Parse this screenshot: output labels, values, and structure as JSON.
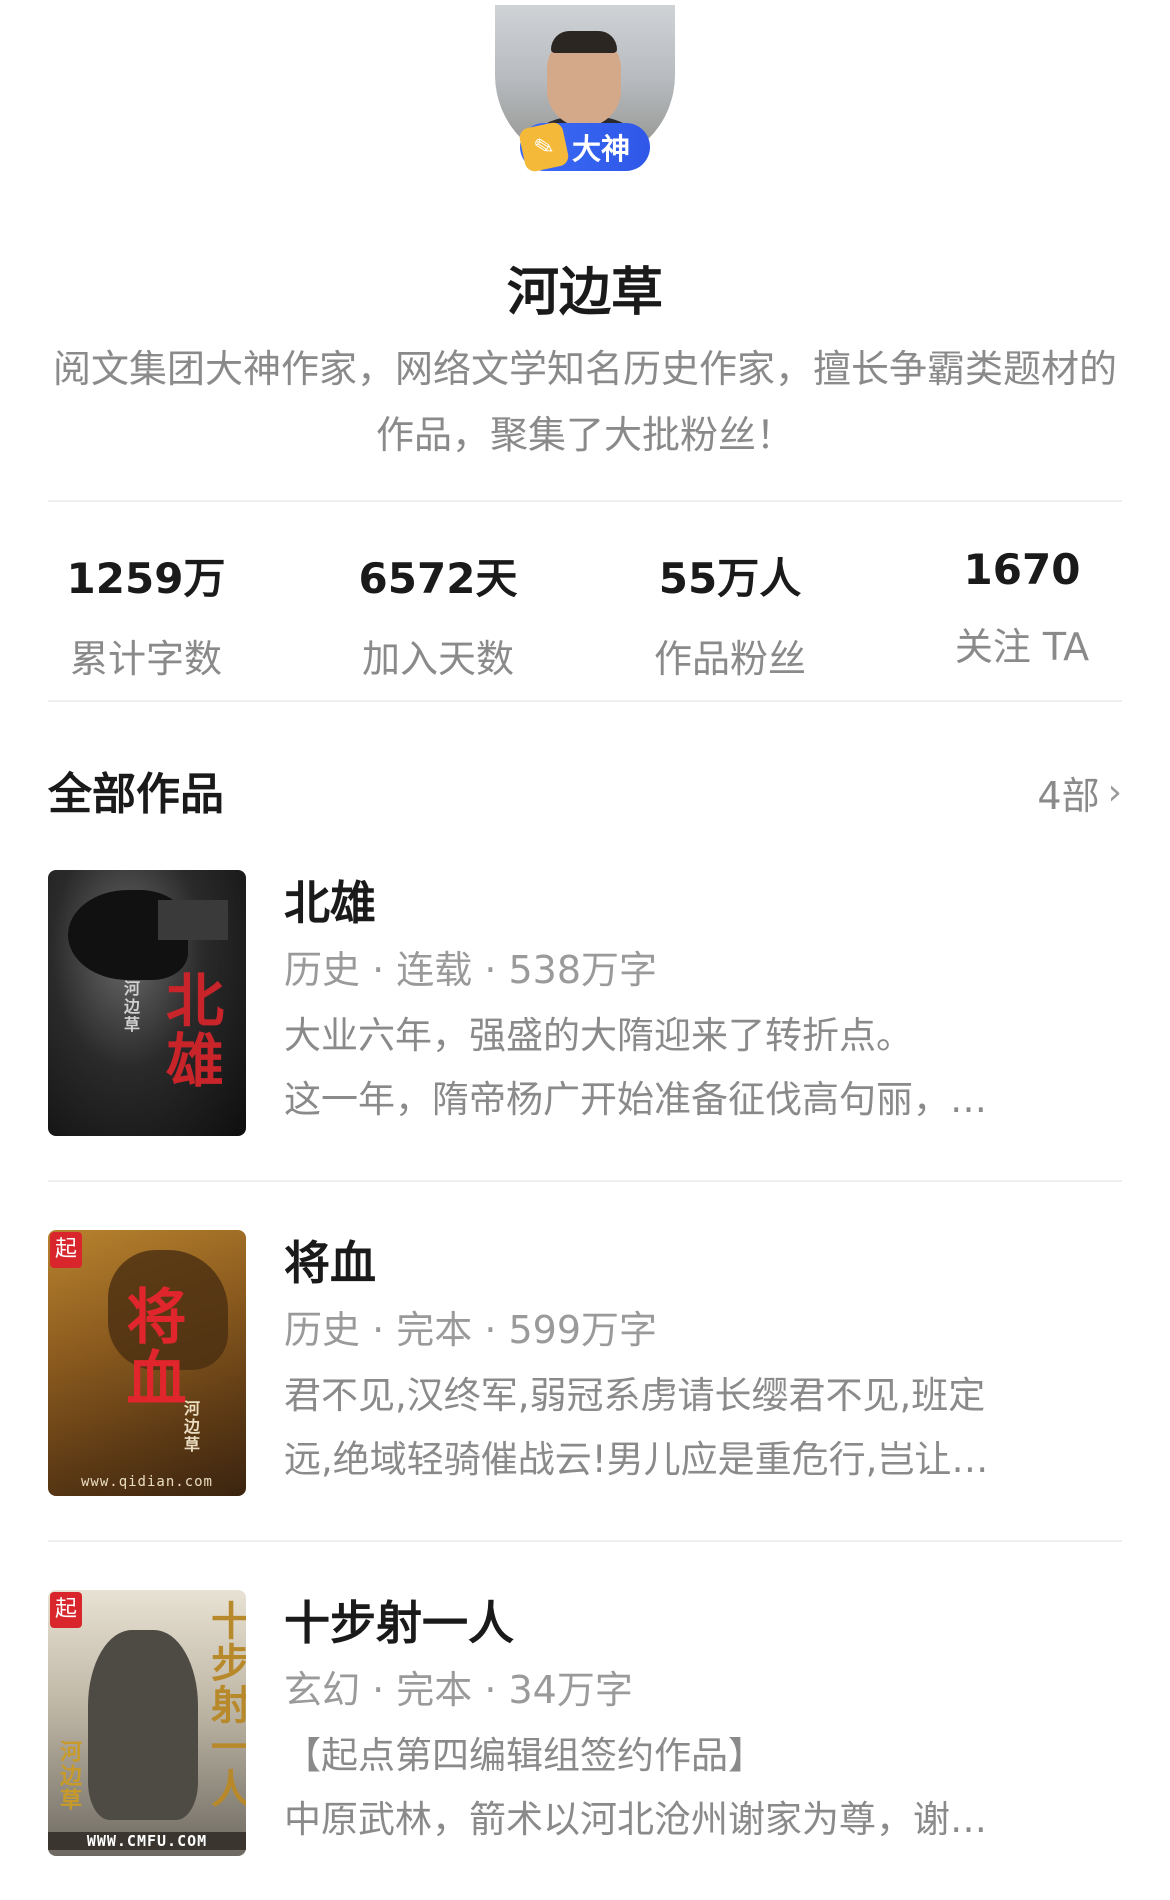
{
  "profile": {
    "badge_label": "大神",
    "name": "河边草",
    "bio": "阅文集团大神作家，网络文学知名历史作家，擅长争霸类题材的作品，聚集了大批粉丝！"
  },
  "stats": [
    {
      "value": "1259万",
      "label": "累计字数"
    },
    {
      "value": "6572天",
      "label": "加入天数"
    },
    {
      "value": "55万人",
      "label": "作品粉丝"
    },
    {
      "value": "1670",
      "label": "关注 TA"
    }
  ],
  "works": {
    "title": "全部作品",
    "count": "4部",
    "books": [
      {
        "title": "北雄",
        "meta": "历史 · 连载 · 538万字",
        "desc_line1": "大业六年，强盛的大隋迎来了转折点。",
        "desc_line2": "这一年，隋帝杨广开始准备征伐高句丽，…",
        "cover_text": "北雄",
        "cover_author": "河边草"
      },
      {
        "title": "将血",
        "meta": "历史 · 完本 · 599万字",
        "desc_line1": "君不见,汉终军,弱冠系虏请长缨君不见,班定",
        "desc_line2": "远,绝域轻骑催战云!男儿应是重危行,岂让…",
        "cover_text": "将血",
        "cover_author": "河边草",
        "cover_url": "www.qidian.com",
        "cover_mark": "起"
      },
      {
        "title": "十步射一人",
        "meta": "玄幻 · 完本 · 34万字",
        "desc_line1": "【起点第四编辑组签约作品】",
        "desc_line2": "中原武林，箭术以河北沧州谢家为尊，谢…",
        "cover_text": "十步射一人",
        "cover_author": "河边草",
        "cover_url": "WWW.CMFU.COM",
        "cover_mark": "起"
      }
    ]
  },
  "colors": {
    "badge_blue": "#3b6cf6",
    "badge_pen": "#f5b93a",
    "text_primary": "#1a1a1a",
    "text_secondary": "#8a8a8a"
  }
}
